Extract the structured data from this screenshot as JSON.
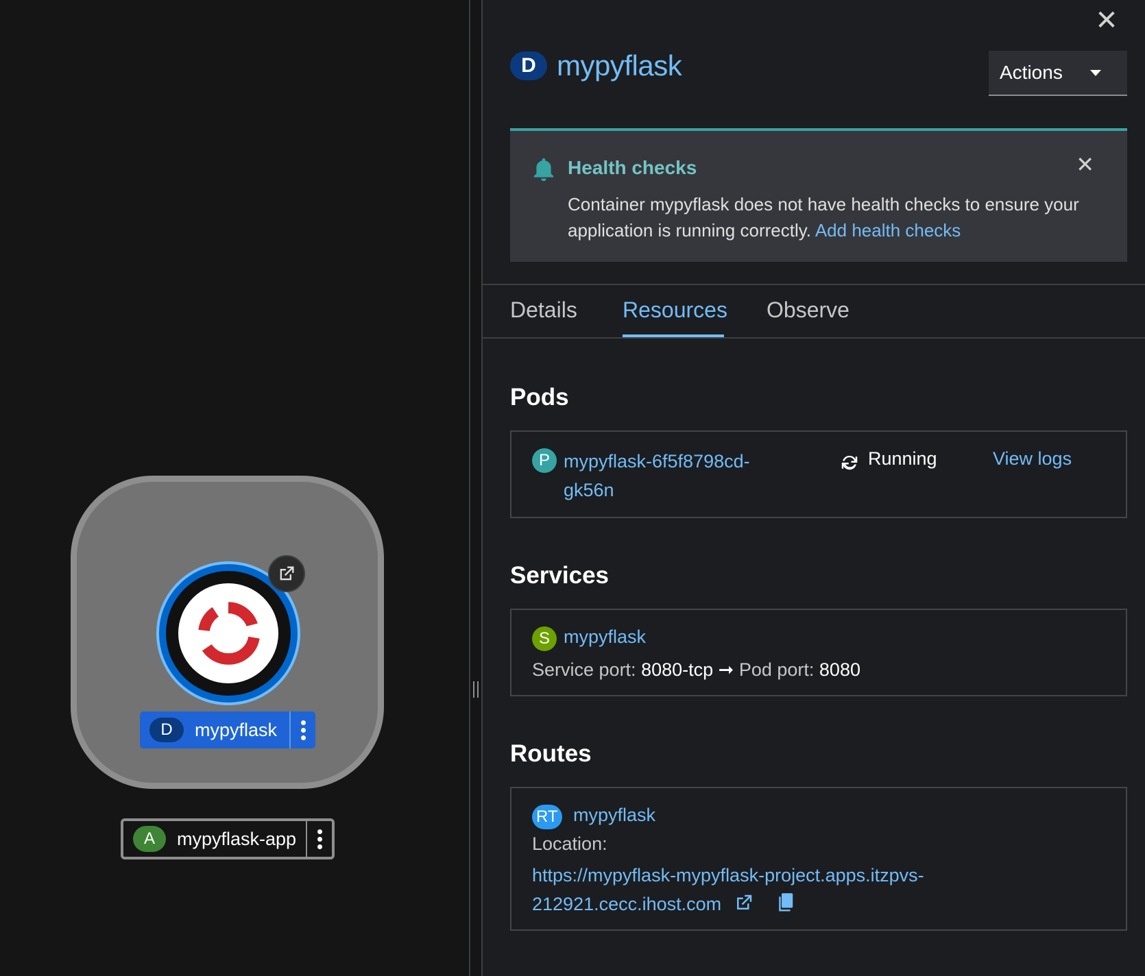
{
  "topology": {
    "node_label": {
      "badge": "D",
      "name": "mypyflask"
    },
    "app_label": {
      "badge": "A",
      "name": "mypyflask-app"
    },
    "colors": {
      "node_ring": "#0066cc",
      "app_badge": "#3e8635",
      "deployment_badge": "#0b3a7e"
    }
  },
  "panel": {
    "title_badge": "D",
    "title": "mypyflask",
    "actions_label": "Actions",
    "close_icon": "close-icon"
  },
  "alert": {
    "title": "Health checks",
    "body": "Container mypyflask does not have health checks to ensure your application is running correctly.",
    "link": "Add health checks"
  },
  "tabs": [
    {
      "label": "Details",
      "active": false
    },
    {
      "label": "Resources",
      "active": true
    },
    {
      "label": "Observe",
      "active": false
    }
  ],
  "pods": {
    "title": "Pods",
    "items": [
      {
        "badge": "P",
        "name_line1": "mypyflask-6f5f8798cd-",
        "name_line2": "gk56n",
        "status": "Running",
        "logs_link": "View logs"
      }
    ]
  },
  "services": {
    "title": "Services",
    "items": [
      {
        "badge": "S",
        "name": "mypyflask",
        "service_port_label": "Service port:",
        "service_port": "8080-tcp",
        "arrow": "➞",
        "pod_port_label": "Pod port:",
        "pod_port": "8080"
      }
    ]
  },
  "routes": {
    "title": "Routes",
    "items": [
      {
        "badge": "RT",
        "name": "mypyflask",
        "location_label": "Location:",
        "url_line1": "https://mypyflask-mypyflask-project.apps.itzpvs-",
        "url_line2": "212921.cecc.ihost.com"
      }
    ]
  }
}
